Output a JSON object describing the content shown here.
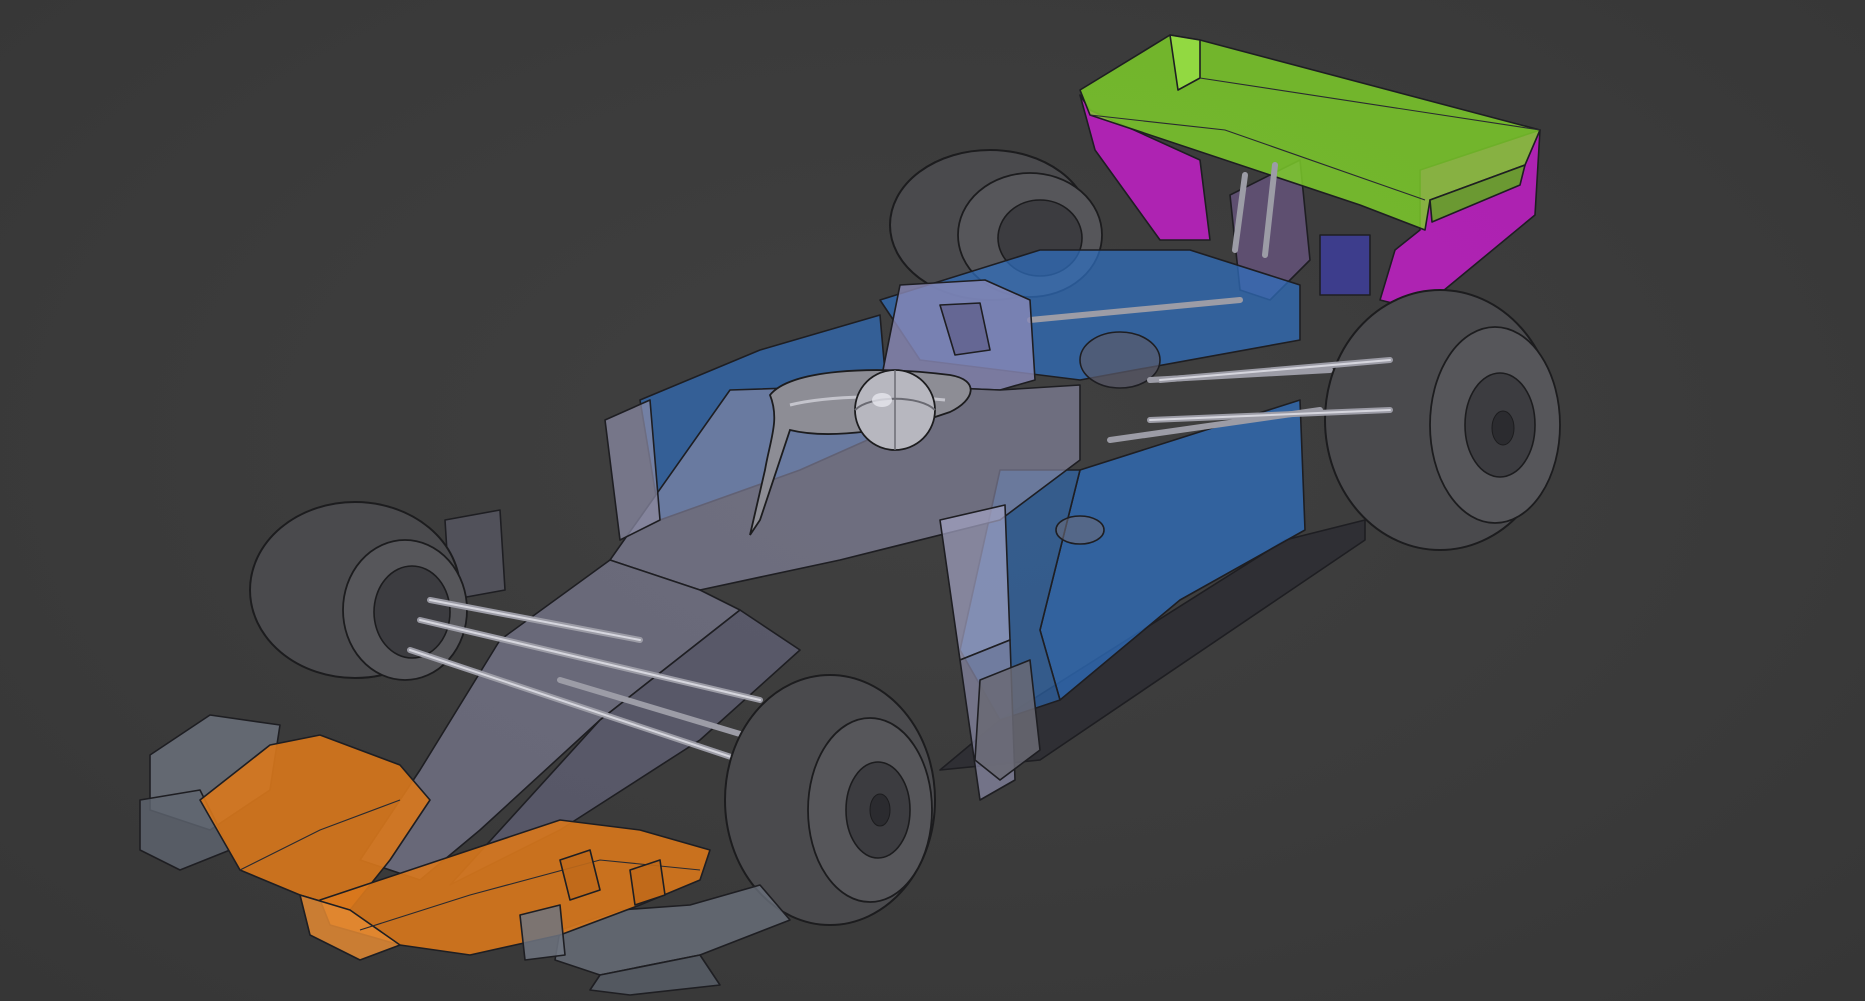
{
  "viewer": {
    "background_color": "#3b3b3b",
    "model_subject": "formula-one-car-cad-model",
    "part_groups": [
      {
        "name": "front-wing",
        "color": "#d9781c"
      },
      {
        "name": "front-wing-endplates",
        "color": "#6e7480"
      },
      {
        "name": "chassis-nose",
        "color": "#8a8aa6"
      },
      {
        "name": "sidepods-engine-cover",
        "color": "#2f6fbf"
      },
      {
        "name": "rear-wing-mainplane",
        "color": "#7fd12a"
      },
      {
        "name": "rear-wing-endplates",
        "color": "#c21fc7"
      },
      {
        "name": "tires",
        "color": "#4a4a4d"
      },
      {
        "name": "suspension-rods",
        "color": "#a8a8b2"
      },
      {
        "name": "halo-helmet",
        "color": "#9a9aa2"
      }
    ]
  }
}
